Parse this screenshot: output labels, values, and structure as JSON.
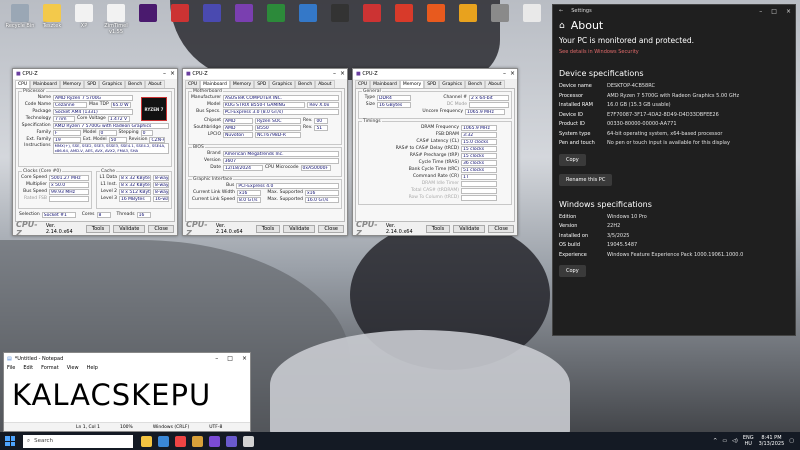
{
  "desktop_icons": [
    {
      "label": "Recycle Bin",
      "color": "#9aa7b5"
    },
    {
      "label": "Tesztek",
      "color": "#f3c94b"
    },
    {
      "label": "XP",
      "color": "#f2f2f2"
    },
    {
      "label": "ZimTimeI v1.55",
      "color": "#f2f2f2"
    },
    {
      "label": "",
      "color": "#4a1a6e"
    },
    {
      "label": "",
      "color": "#c33"
    },
    {
      "label": "",
      "color": "#4a4ab0"
    },
    {
      "label": "",
      "color": "#7a3fb0"
    },
    {
      "label": "",
      "color": "#2c8a3a"
    },
    {
      "label": "",
      "color": "#3478c8"
    },
    {
      "label": "",
      "color": "#333"
    },
    {
      "label": "",
      "color": "#c33"
    },
    {
      "label": "",
      "color": "#d83a2a"
    },
    {
      "label": "",
      "color": "#e85a1e"
    },
    {
      "label": "",
      "color": "#e8a21e"
    },
    {
      "label": "",
      "color": "#8a8a8a"
    },
    {
      "label": "",
      "color": "#e9e9e9"
    }
  ],
  "cpuz1": {
    "title": "CPU-Z",
    "tabs": [
      "CPU",
      "Mainboard",
      "Memory",
      "SPD",
      "Graphics",
      "Bench",
      "About"
    ],
    "processor": {
      "group": "Processor",
      "name_l": "Name",
      "name": "AMD Ryzen 7 5700G",
      "code_l": "Code Name",
      "code": "Cezanne",
      "tdp_l": "Max TDP",
      "tdp": "65.0 W",
      "pkg_l": "Package",
      "pkg": "Socket AM4 (1331)",
      "tech_l": "Technology",
      "tech": "7 nm",
      "cv_l": "Core Voltage",
      "cv": "1.472 V",
      "spec_l": "Specification",
      "spec": "AMD Ryzen 7 5700G with Radeon Graphics",
      "fam_l": "Family",
      "fam": "F",
      "model_l": "Model",
      "model": "0",
      "step_l": "Stepping",
      "step": "0",
      "efam_l": "Ext. Family",
      "efam": "19",
      "emod_l": "Ext. Model",
      "emod": "50",
      "rev_l": "Revision",
      "rev": "CZN-A0",
      "inst_l": "Instructions",
      "inst": "MMX(+), SSE, SSE2, SSE3, SSSE3, SSE4.1, SSE4.2, SSE4A, x86-64, AMD-V, AES, AVX, AVX2, FMA3, SHA",
      "logo": "RYZEN 7"
    },
    "clocks": {
      "group": "Clocks (Core #0)",
      "cs_l": "Core Speed",
      "cs": "5001.27 MHz",
      "mul_l": "Multiplier",
      "mul": "x 50.0",
      "bus_l": "Bus Speed",
      "bus": "99.93 MHz",
      "fsb_l": "Rated FSB",
      "fsb": ""
    },
    "cache": {
      "group": "Cache",
      "l1d_l": "L1 Data",
      "l1d": "8 x 32 KBytes",
      "l1d_w": "8-way",
      "l1i_l": "L1 Inst.",
      "l1i": "8 x 32 KBytes",
      "l1i_w": "8-way",
      "l2_l": "Level 2",
      "l2": "8 x 512 KBytes",
      "l2_w": "8-way",
      "l3_l": "Level 3",
      "l3": "16 MBytes",
      "l3_w": "16-way"
    },
    "sel_l": "Selection",
    "sel": "Socket #1",
    "cores_l": "Cores",
    "cores": "8",
    "thr_l": "Threads",
    "thr": "16"
  },
  "cpuz2": {
    "title": "CPU-Z",
    "tabs": [
      "CPU",
      "Mainboard",
      "Memory",
      "SPD",
      "Graphics",
      "Bench",
      "About"
    ],
    "mb": {
      "group": "Motherboard",
      "man_l": "Manufacturer",
      "man": "ASUSTeK COMPUTER INC.",
      "model_l": "Model",
      "model": "ROG STRIX B550-I GAMING",
      "rev": "Rev X.0x",
      "bus_l": "Bus Specs.",
      "bus": "PCI-Express 3.0 (8.0 GT/s)",
      "chip_l": "Chipset",
      "chip": "AMD",
      "chip2": "Ryzen SOC",
      "chiprev_l": "Rev.",
      "chiprev": "00",
      "sb_l": "Southbridge",
      "sb": "AMD",
      "sb2": "B550",
      "sbrev": "51",
      "lpc_l": "LPCIO",
      "lpc": "Nuvoton",
      "lpc2": "NCT6798D-R"
    },
    "bios": {
      "group": "BIOS",
      "brand_l": "Brand",
      "brand": "American Megatrends Inc.",
      "ver_l": "Version",
      "ver": "3607",
      "date_l": "Date",
      "date": "12/18/2024",
      "mc_l": "CPU Microcode",
      "mc": "0xA50000F"
    },
    "gi": {
      "group": "Graphic Interface",
      "bus_l": "Bus",
      "bus": "PCI-Express 4.0",
      "clw_l": "Current Link Width",
      "clw": "x16",
      "msw_l": "Max. Supported",
      "msw": "x16",
      "cls_l": "Current Link Speed",
      "cls": "8.0 GT/s",
      "mss_l": "Max. Supported",
      "mss": "16.0 GT/s"
    }
  },
  "cpuz3": {
    "title": "CPU-Z",
    "tabs": [
      "CPU",
      "Mainboard",
      "Memory",
      "SPD",
      "Graphics",
      "Bench",
      "About"
    ],
    "gen": {
      "group": "General",
      "type_l": "Type",
      "type": "DDR4",
      "ch_l": "Channel #",
      "ch": "2 x 64-bit",
      "size_l": "Size",
      "size": "16 GBytes",
      "dc_l": "DC Mode",
      "dc": "",
      "uf_l": "Uncore Frequency",
      "uf": "1065.9 MHz"
    },
    "tim": {
      "group": "Timings",
      "rows": [
        {
          "l": "DRAM Frequency",
          "v": "1065.9 MHz"
        },
        {
          "l": "FSB:DRAM",
          "v": "3:32"
        },
        {
          "l": "CAS# Latency (CL)",
          "v": "15.0 clocks"
        },
        {
          "l": "RAS# to CAS# Delay (tRCD)",
          "v": "15 clocks"
        },
        {
          "l": "RAS# Precharge (tRP)",
          "v": "15 clocks"
        },
        {
          "l": "Cycle Time (tRAS)",
          "v": "36 clocks"
        },
        {
          "l": "Bank Cycle Time (tRC)",
          "v": "51 clocks"
        },
        {
          "l": "Command Rate (CR)",
          "v": "1T"
        },
        {
          "l": "DRAM Idle Timer",
          "v": ""
        },
        {
          "l": "Total CAS# (tRDRAM)",
          "v": ""
        },
        {
          "l": "Row To Column (tRCD)",
          "v": ""
        }
      ]
    }
  },
  "cpuz_footer": {
    "logo": "CPU-Z",
    "ver": "Ver. 2.14.0.x64",
    "tools": "Tools",
    "validate": "Validate",
    "close": "Close"
  },
  "settings": {
    "app": "Settings",
    "title": "About",
    "protected": "Your PC is monitored and protected.",
    "link": "See details in Windows Security",
    "dev_title": "Device specifications",
    "dev": [
      {
        "k": "Device name",
        "v": "DESKTOP-4CB58RC"
      },
      {
        "k": "Processor",
        "v": "AMD Ryzen 7 5700G with Radeon Graphics 5.00 GHz"
      },
      {
        "k": "Installed RAM",
        "v": "16.0 GB (15.3 GB usable)"
      },
      {
        "k": "Device ID",
        "v": "E7F70087-3F17-4DA2-8D49-D4D33DBFEE26"
      },
      {
        "k": "Product ID",
        "v": "00330-80000-00000-AA771"
      },
      {
        "k": "System type",
        "v": "64-bit operating system, x64-based processor"
      },
      {
        "k": "Pen and touch",
        "v": "No pen or touch input is available for this display"
      }
    ],
    "copy": "Copy",
    "rename": "Rename this PC",
    "win_title": "Windows specifications",
    "win": [
      {
        "k": "Edition",
        "v": "Windows 10 Pro"
      },
      {
        "k": "Version",
        "v": "22H2"
      },
      {
        "k": "Installed on",
        "v": "3/5/2025"
      },
      {
        "k": "OS build",
        "v": "19045.5487"
      },
      {
        "k": "Experience",
        "v": "Windows Feature Experience Pack 1000.19061.1000.0"
      }
    ],
    "copy2": "Copy"
  },
  "notepad": {
    "title": "*Untitled - Notepad",
    "menu": [
      "File",
      "Edit",
      "Format",
      "View",
      "Help"
    ],
    "text": "KALACSKEPU",
    "status": [
      "Ln 1, Col 1",
      "100%",
      "Windows (CRLF)",
      "UTF-8"
    ]
  },
  "taskbar": {
    "search": "Search",
    "apps": [
      "#f4c542",
      "#3a88d8",
      "#e44",
      "#d8a13a",
      "#7b4bd6",
      "#6a5acd",
      "#d3d3d3"
    ],
    "lang1": "ENG",
    "lang2": "HU",
    "time": "8:41 PM",
    "date": "3/13/2025"
  }
}
